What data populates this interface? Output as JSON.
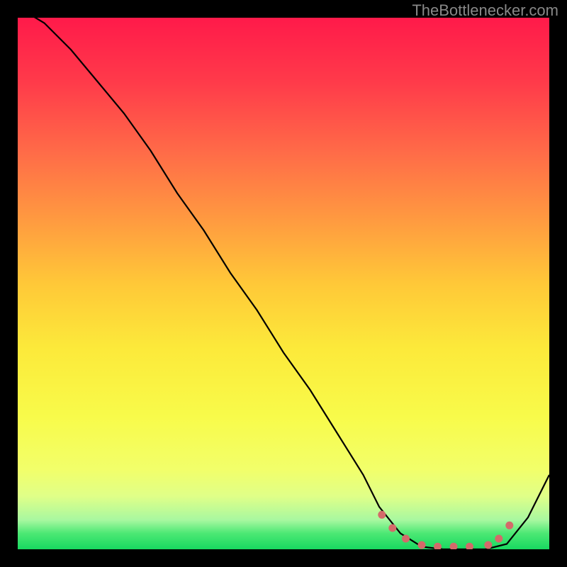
{
  "watermark": "TheBottlenecker.com",
  "chart_data": {
    "type": "line",
    "title": "",
    "xlabel": "",
    "ylabel": "",
    "xlim": [
      0,
      100
    ],
    "ylim": [
      0,
      100
    ],
    "series": [
      {
        "name": "curve",
        "x": [
          0,
          5,
          10,
          15,
          20,
          25,
          30,
          35,
          40,
          45,
          50,
          55,
          60,
          65,
          68,
          72,
          76,
          80,
          84,
          88,
          92,
          96,
          100
        ],
        "values": [
          102,
          99,
          94,
          88,
          82,
          75,
          67,
          60,
          52,
          45,
          37,
          30,
          22,
          14,
          8,
          3,
          0.5,
          0,
          0,
          0,
          1,
          6,
          14
        ]
      }
    ],
    "markers": {
      "name": "dots",
      "color": "#d46a6a",
      "x": [
        68.5,
        70.5,
        73,
        76,
        79,
        82,
        85,
        88.5,
        90.5,
        92.5
      ],
      "values": [
        6.5,
        4,
        2,
        0.8,
        0.5,
        0.5,
        0.5,
        0.8,
        2,
        4.5
      ]
    },
    "gradient_desc": "vertical red-to-green heatmap background"
  }
}
